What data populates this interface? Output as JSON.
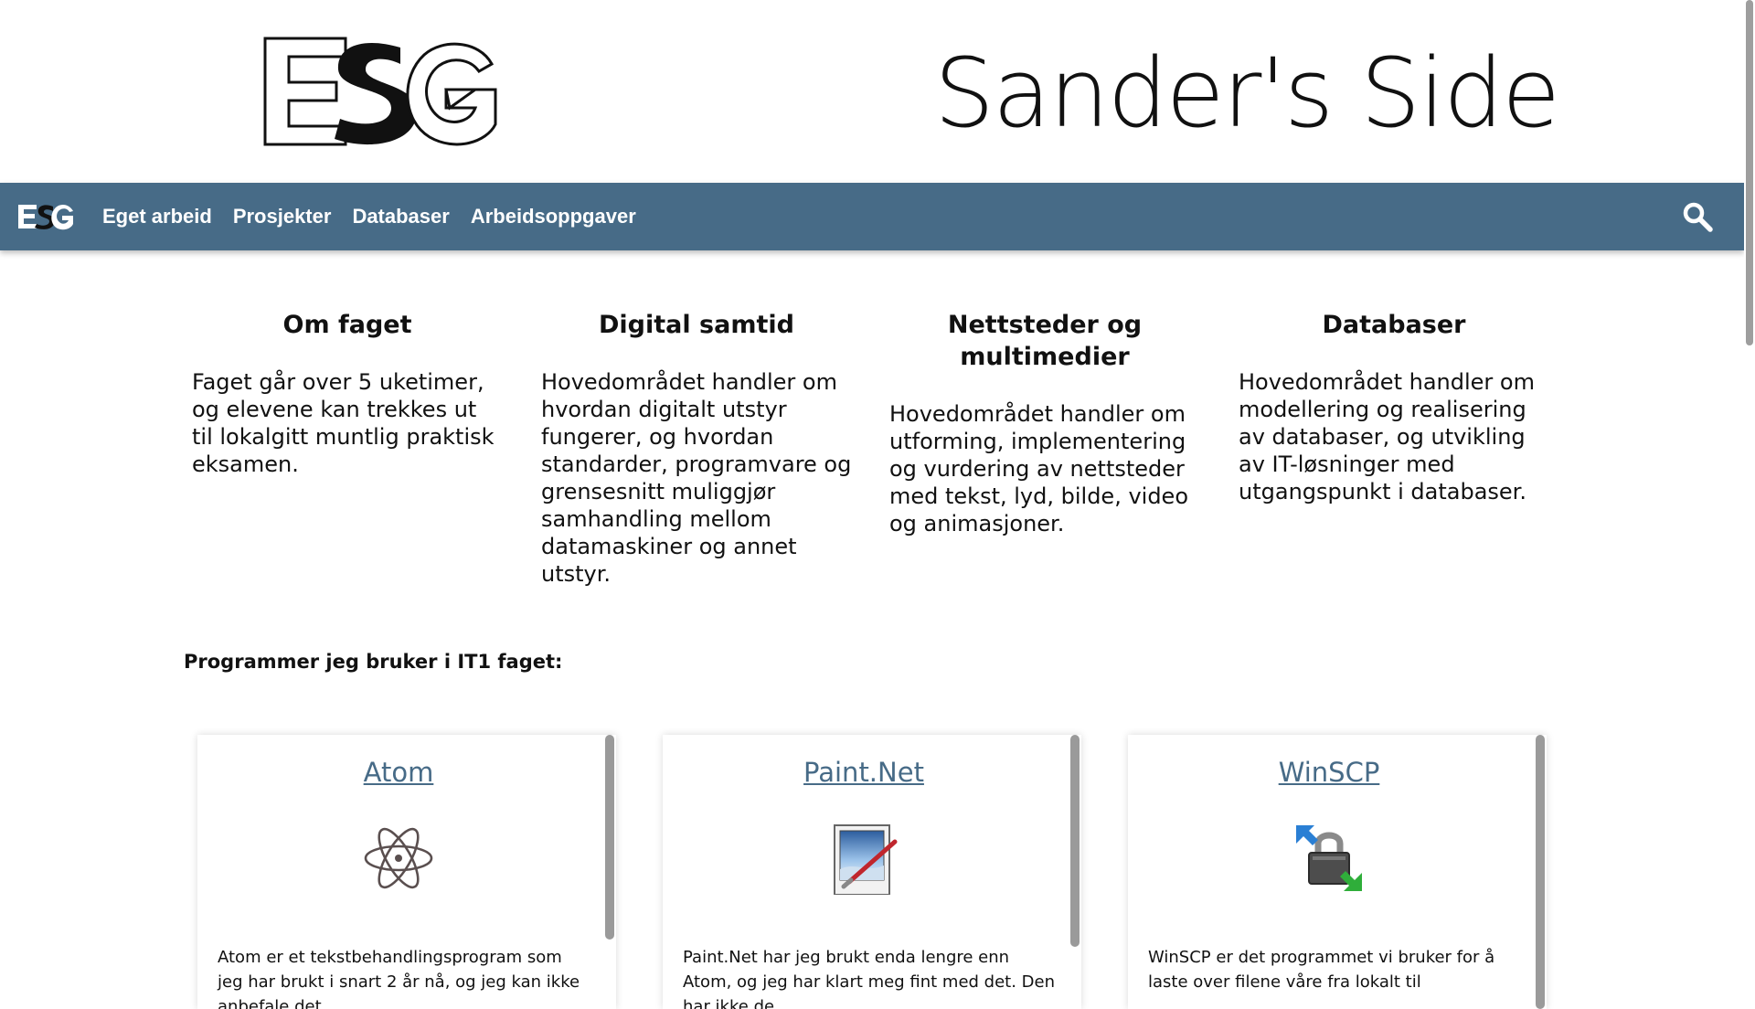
{
  "header": {
    "logo_text": "ESG",
    "title": "Sander's Side"
  },
  "nav": {
    "logo_text": "ESG",
    "links": [
      "Eget arbeid",
      "Prosjekter",
      "Databaser",
      "Arbeidsoppgaver"
    ],
    "search_icon": "search-icon"
  },
  "info": [
    {
      "title": "Om faget",
      "text": "Faget går over 5 uketimer, og elevene kan trekkes ut til lokalgitt muntlig praktisk eksamen."
    },
    {
      "title": "Digital samtid",
      "text": "Hovedområdet handler om hvordan digitalt utstyr fungerer, og hvordan standarder, programvare og grensesnitt muliggjør samhandling mellom datamaskiner og annet utstyr."
    },
    {
      "title": "Nettsteder og multimedier",
      "text": "Hovedområdet handler om utforming, implementering og vurdering av nettsteder med tekst, lyd, bilde, video og animasjoner."
    },
    {
      "title": "Databaser",
      "text": "Hovedområdet handler om modellering og realisering av databaser, og utvikling av IT-løsninger med utgangspunkt i databaser."
    }
  ],
  "programs_heading": "Programmer jeg bruker i IT1 faget:",
  "cards": [
    {
      "title": "Atom",
      "icon": "atom-icon",
      "text": "Atom er et tekstbehandlingsprogram som jeg har brukt i snart 2 år nå, og jeg kan ikke anbefale det"
    },
    {
      "title": "Paint.Net",
      "icon": "paint-net-icon",
      "text": "Paint.Net har jeg brukt enda lengre enn Atom, og jeg har klart meg fint med det. Den har ikke de"
    },
    {
      "title": "WinSCP",
      "icon": "winscp-icon",
      "text": "WinSCP er det programmet vi bruker for å laste over filene våre fra lokalt til"
    }
  ],
  "colors": {
    "navbar": "#476b87",
    "link": "#476b87",
    "text": "#111111"
  }
}
